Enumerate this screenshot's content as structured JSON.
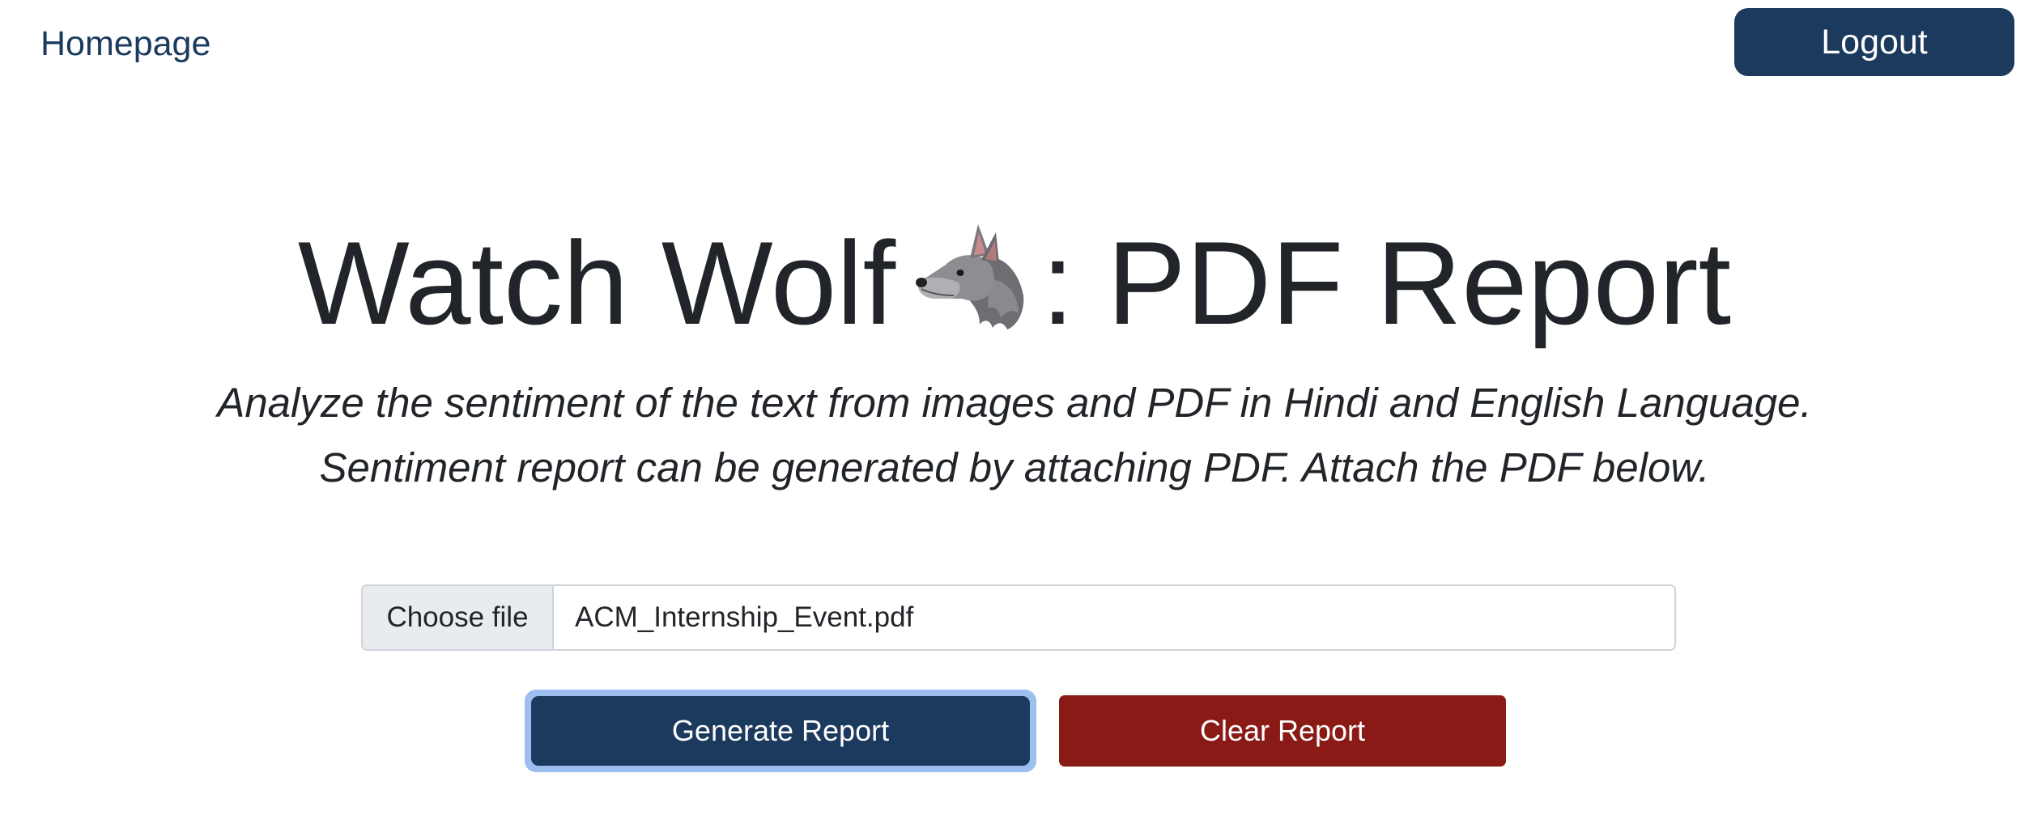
{
  "nav": {
    "home_label": "Homepage",
    "logout_label": "Logout"
  },
  "header": {
    "title_before": "Watch Wolf",
    "title_icon": "wolf-emoji-icon",
    "title_after": ": PDF Report"
  },
  "description": {
    "line1": "Analyze the sentiment of the text from images and PDF in Hindi and English Language.",
    "line2": "Sentiment report can be generated by attaching PDF. Attach the PDF below."
  },
  "upload": {
    "choose_label": "Choose file",
    "file_name": "ACM_Internship_Event.pdf"
  },
  "actions": {
    "generate_label": "Generate Report",
    "clear_label": "Clear Report"
  },
  "colors": {
    "primary": "#1b3a5e",
    "danger": "#8a1a16",
    "focus_ring": "#9cbff0",
    "text": "#212529"
  }
}
